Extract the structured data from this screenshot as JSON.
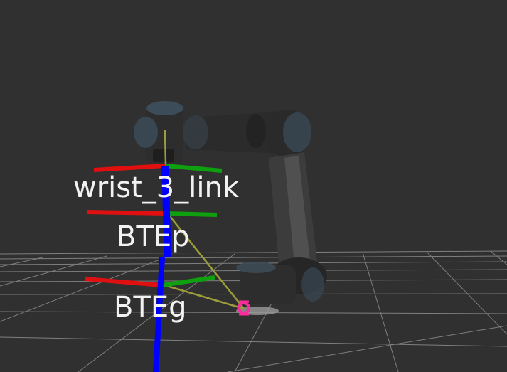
{
  "viewer": {
    "background": "#303030",
    "grid_color": "#a0a0a0"
  },
  "frames": [
    {
      "label": "wrist_3_link"
    },
    {
      "label": "BTEp"
    },
    {
      "label": "BTEg"
    }
  ],
  "colors": {
    "x_axis": "#e01010",
    "y_axis": "#0fa00f",
    "z_axis": "#0000ff",
    "tf_link": "#9c9c3c",
    "robot_body": "#2a2a2a",
    "robot_cap": "#3a4a55",
    "marker": "#ff2a9c"
  },
  "icons": {
    "gripper_marker": "target-marker-icon"
  }
}
